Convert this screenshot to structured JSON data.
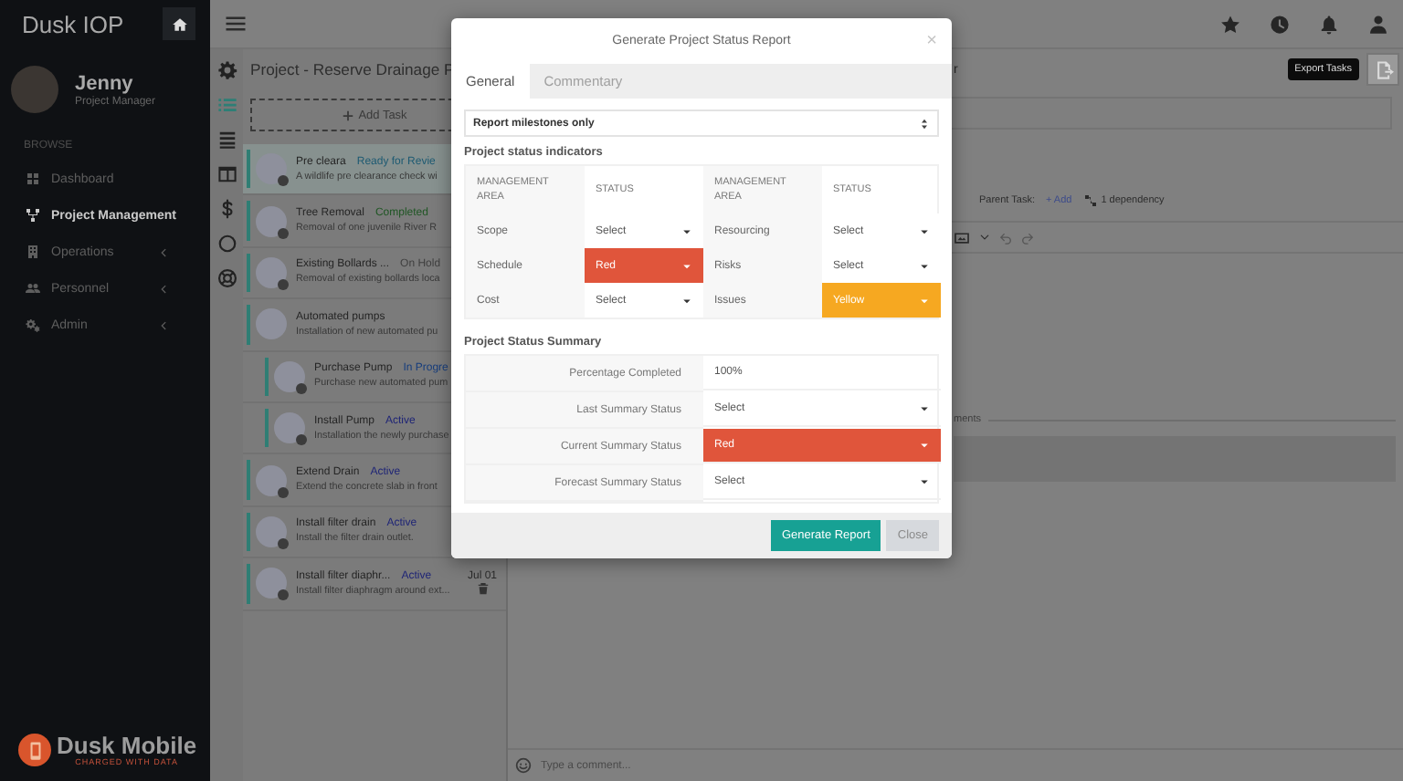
{
  "sidebar": {
    "brand": "Dusk IOP",
    "user": {
      "name": "Jenny",
      "role": "Project Manager"
    },
    "section": "BROWSE",
    "items": [
      {
        "label": "Dashboard",
        "selected": false,
        "expandable": false
      },
      {
        "label": "Project Management",
        "selected": true,
        "expandable": false
      },
      {
        "label": "Operations",
        "selected": false,
        "expandable": true
      },
      {
        "label": "Personnel",
        "selected": false,
        "expandable": true
      },
      {
        "label": "Admin",
        "selected": false,
        "expandable": true
      }
    ],
    "logo": {
      "name": "Dusk Mobile",
      "tagline": "CHARGED WITH DATA"
    }
  },
  "tool_strip": [
    {
      "selected": false
    },
    {
      "selected": true
    },
    {
      "selected": false
    },
    {
      "selected": false
    },
    {
      "selected": false
    },
    {
      "selected": false
    },
    {
      "selected": false
    }
  ],
  "project": {
    "title": "Project - Reserve Drainage P",
    "add_task": "Add Task",
    "tasks": [
      {
        "name": "Pre cleara",
        "status": "Ready for Revie",
        "color": "#1d5a72",
        "description": "A wildlife pre clearance check wi",
        "selected": true,
        "assigned": true
      },
      {
        "name": "Tree Removal",
        "status": "Completed",
        "color": "#1f5624",
        "description": "Removal of one juvenile River R",
        "selected": false,
        "assigned": true
      },
      {
        "name": "Existing Bollards ...",
        "status": "On Hold",
        "color": "#404040",
        "description": "Removal of existing bollards loca",
        "selected": false,
        "assigned": true
      },
      {
        "name": "Automated pumps",
        "description": "Installation of new automated pu",
        "selected": false,
        "assigned": false,
        "children": [
          {
            "name": "Purchase Pump",
            "status": "In Progre",
            "color": "#163d7c",
            "description": "Purchase new automated pum",
            "selected": false,
            "assigned": true
          },
          {
            "name": "Install Pump",
            "status": "Active",
            "color": "#1e2476",
            "description": "Installation the newly purchase",
            "selected": false,
            "assigned": true
          }
        ]
      },
      {
        "name": "Extend Drain",
        "status": "Active",
        "color": "#1e2476",
        "description": "Extend the concrete slab in front",
        "selected": false,
        "assigned": true
      },
      {
        "name": "Install filter drain",
        "status": "Active",
        "color": "#1e2476",
        "description": "Install the filter drain outlet.",
        "selected": false,
        "assigned": true
      },
      {
        "name": "Install filter diaphr...",
        "status": "Active",
        "color": "#1e2476",
        "description": "Install filter diaphragm around ext...",
        "selected": false,
        "assigned": true,
        "date": "Jul 01"
      }
    ]
  },
  "detail": {
    "label_fragment": "r",
    "tooltip": "Export Tasks",
    "parent_task_label": "Parent Task:",
    "add_link": "+ Add",
    "dependency": "1 dependency",
    "comments_fragment": "ments",
    "comment_placeholder": "Type a comment..."
  },
  "modal": {
    "title": "Generate Project Status Report",
    "close": "×",
    "tabs": [
      {
        "label": "General",
        "selected": true
      },
      {
        "label": "Commentary",
        "selected": false
      }
    ],
    "report_select": "Report milestones only",
    "indicators_heading": "Project status indicators",
    "indicator_columns": [
      "MANAGEMENT AREA",
      "STATUS",
      "MANAGEMENT AREA",
      "STATUS"
    ],
    "indicators": [
      {
        "left": {
          "area": "Scope",
          "status": "Select"
        },
        "right": {
          "area": "Resourcing",
          "status": "Select"
        }
      },
      {
        "left": {
          "area": "Schedule",
          "status": "Red",
          "color": "#e0553b"
        },
        "right": {
          "area": "Risks",
          "status": "Select"
        }
      },
      {
        "left": {
          "area": "Cost",
          "status": "Select"
        },
        "right": {
          "area": "Issues",
          "status": "Yellow",
          "color": "#f6a821"
        }
      }
    ],
    "summary_heading": "Project Status Summary",
    "summary": [
      {
        "label": "Percentage Completed",
        "kind": "text",
        "value": "100%"
      },
      {
        "label": "Last Summary Status",
        "kind": "select",
        "value": "Select"
      },
      {
        "label": "Current Summary Status",
        "kind": "select",
        "value": "Red",
        "color": "#e0553b"
      },
      {
        "label": "Forecast Summary Status",
        "kind": "select",
        "value": "Select"
      }
    ],
    "buttons": [
      {
        "label": "Generate Report",
        "kind": "primary"
      },
      {
        "label": "Close",
        "kind": "secondary"
      }
    ]
  }
}
